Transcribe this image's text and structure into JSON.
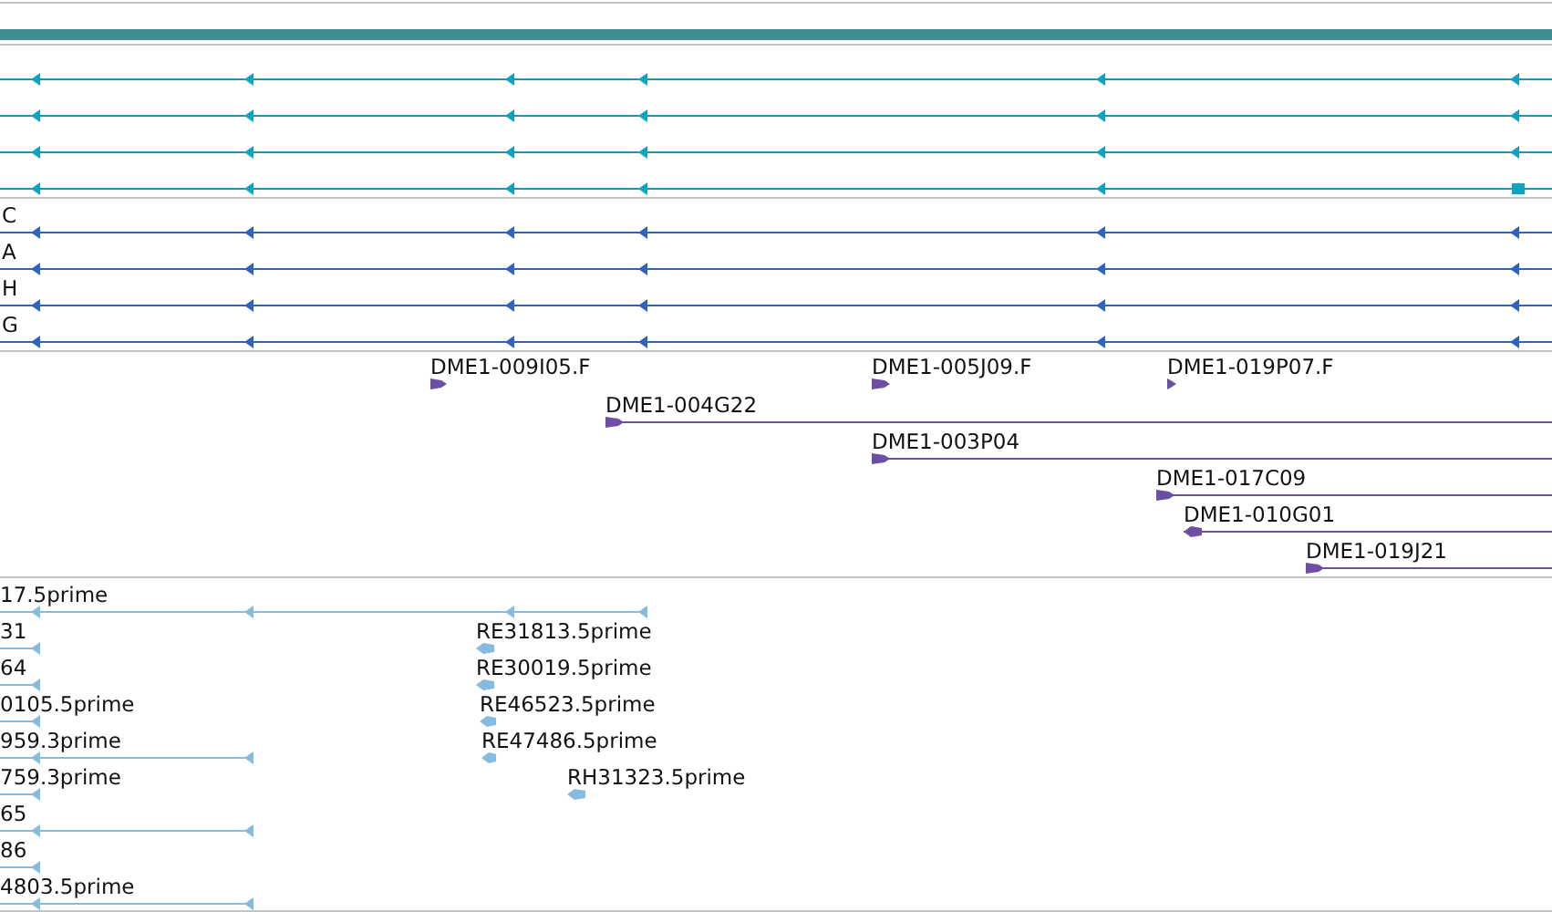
{
  "transcripts": [
    {
      "kind": "reverse"
    },
    {
      "kind": "reverse"
    },
    {
      "kind": "reverse"
    },
    {
      "kind": "reverse"
    }
  ],
  "gene_models": [
    {
      "label": "C",
      "kind": "reverse"
    },
    {
      "label": "A",
      "kind": "reverse"
    },
    {
      "label": "H",
      "kind": "reverse"
    },
    {
      "label": "G",
      "kind": "reverse"
    }
  ],
  "clones": [
    {
      "label": "DME1-009I05.F",
      "kind": "forward"
    },
    {
      "label": "DME1-005J09.F",
      "kind": "forward"
    },
    {
      "label": "DME1-019P07.F",
      "kind": "forward"
    },
    {
      "label": "DME1-004G22",
      "kind": "forward"
    },
    {
      "label": "DME1-003P04",
      "kind": "forward"
    },
    {
      "label": "DME1-017C09",
      "kind": "forward"
    },
    {
      "label": "DME1-010G01",
      "kind": "reverse"
    },
    {
      "label": "DME1-019J21",
      "kind": "forward"
    }
  ],
  "ests": [
    {
      "label": "17.5prime",
      "kind": "reverse"
    },
    {
      "label": "31",
      "kind": "reverse"
    },
    {
      "label": "RE31813.5prime",
      "kind": "reverse"
    },
    {
      "label": "64",
      "kind": "reverse"
    },
    {
      "label": "RE30019.5prime",
      "kind": "reverse"
    },
    {
      "label": "0105.5prime",
      "kind": "reverse"
    },
    {
      "label": "RE46523.5prime",
      "kind": "reverse"
    },
    {
      "label": "959.3prime",
      "kind": "reverse"
    },
    {
      "label": "RE47486.5prime",
      "kind": "reverse"
    },
    {
      "label": "759.3prime",
      "kind": "reverse"
    },
    {
      "label": "RH31323.5prime",
      "kind": "reverse"
    },
    {
      "label": "65",
      "kind": "reverse"
    },
    {
      "label": "86",
      "kind": "reverse"
    },
    {
      "label": "4803.5prime",
      "kind": "reverse"
    }
  ]
}
